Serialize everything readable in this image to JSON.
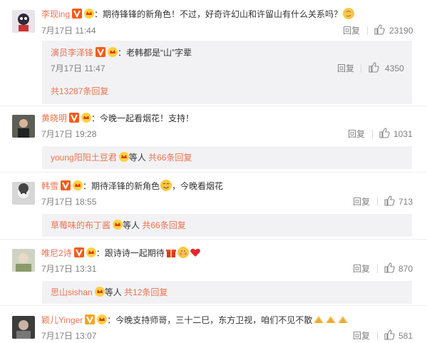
{
  "comments": [
    {
      "user": "李现ing",
      "text": "：期待锋锋的新角色！不过，好奇许幻山和许留山有什么关系吗？",
      "time": "7月17日 11:44",
      "reply_label": "回复",
      "likes": "23190",
      "sub_reply": {
        "user": "演员李泽锋",
        "text": "：老韩都是“山”字辈",
        "time": "7月17日 11:47",
        "reply_label": "回复",
        "likes": "4350"
      },
      "more_replies": "共13287条回复"
    },
    {
      "user": "黄晓明",
      "text": "：今晚一起看烟花！支持！",
      "time": "7月17日 19:28",
      "reply_label": "回复",
      "likes": "1031",
      "summary_user": "young阳阳土豆君",
      "summary_mid": "等人",
      "summary_count": "共66条回复"
    },
    {
      "user": "韩雪",
      "text": "：期待泽锋的新角色",
      "text2": "，今晚看烟花",
      "time": "7月17日 18:55",
      "reply_label": "回复",
      "likes": "713",
      "summary_user": "草莓味的布丁酱",
      "summary_mid": "等人",
      "summary_count": "共66条回复"
    },
    {
      "user": "唯尼2诗",
      "text": "：跟诗诗一起期待",
      "time": "7月17日 13:31",
      "reply_label": "回复",
      "likes": "870",
      "summary_user": "思山sishan",
      "summary_mid": "等人",
      "summary_count": "共12条回复"
    },
    {
      "user": "颖儿Yinger",
      "text": "：今晚支持师哥，三十二巳，东方卫视，咱们不见不散",
      "time": "7月17日 13:07",
      "reply_label": "回复",
      "likes": "581"
    }
  ],
  "colors": {
    "username": "#eb7350",
    "muted": "#808080",
    "box": "#f2f2f5"
  },
  "icons": [
    "verified-v-icon",
    "vip-crown-icon",
    "thumbs-up-icon",
    "emoji-icon",
    "heart-icon"
  ]
}
